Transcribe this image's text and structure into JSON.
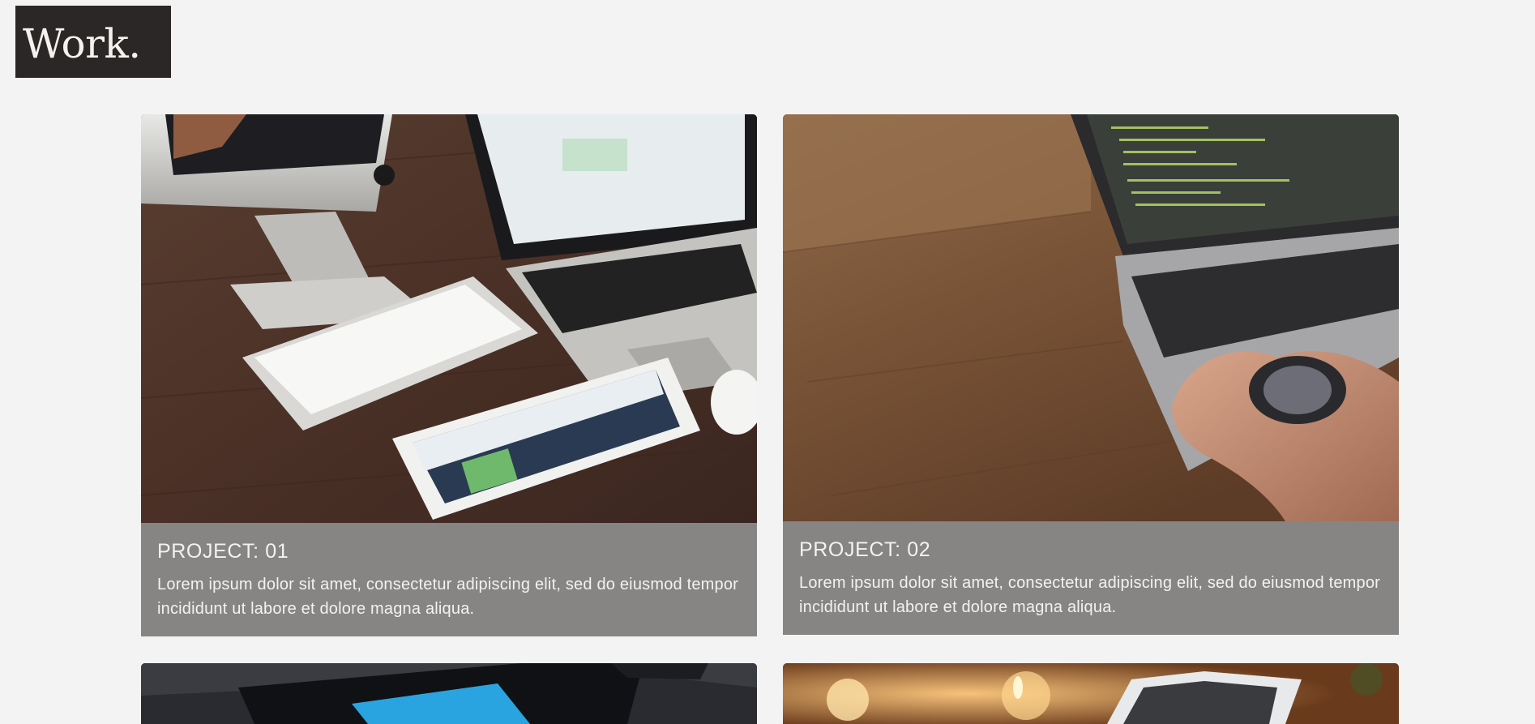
{
  "header": {
    "logo_text": "Work."
  },
  "projects": [
    {
      "title": "PROJECT: 01",
      "description": "Lorem ipsum dolor sit amet, consectetur adipiscing elit, sed do eiusmod tempor incididunt ut labore et dolore magna aliqua.",
      "image": "desk-with-imac-macbook-ipad-keyboard"
    },
    {
      "title": "PROJECT: 02",
      "description": "Lorem ipsum dolor sit amet, consectetur adipiscing elit, sed do eiusmod tempor incididunt ut labore et dolore magna aliqua.",
      "image": "hand-typing-on-laptop-with-code"
    },
    {
      "image": "smartphone-on-dark-desk"
    },
    {
      "image": "phone-with-candles"
    }
  ],
  "colors": {
    "page_background": "#f2f3f2",
    "logo_background": "#2b2726",
    "caption_background": "#878584",
    "caption_text": "#f3f2f0"
  }
}
